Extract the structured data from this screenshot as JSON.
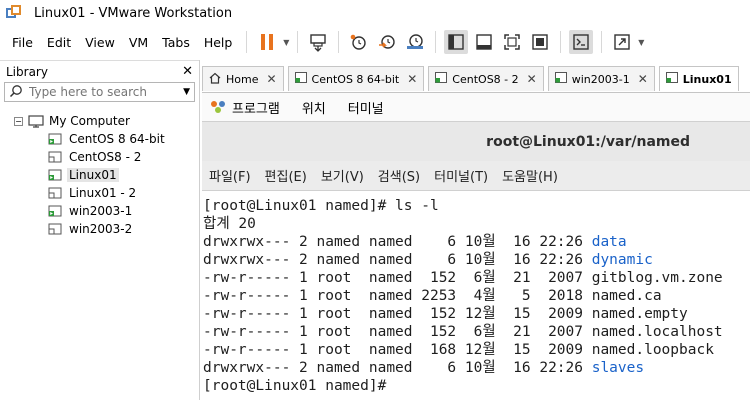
{
  "window": {
    "title": "Linux01 - VMware Workstation"
  },
  "menu": [
    "File",
    "Edit",
    "View",
    "VM",
    "Tabs",
    "Help"
  ],
  "toolbar": {
    "icons": [
      "pause-icon",
      "send-ctrl-alt-del-icon",
      "snapshot-icon",
      "revert-snapshot-icon",
      "snapshot-manager-icon",
      "library-view-icon",
      "thumbnail-view-icon",
      "fullscreen-icon",
      "unity-icon",
      "console-view-icon",
      "stretch-guest-icon"
    ],
    "colors": {
      "pause": "#e8731e",
      "accent": "#4a7fc0"
    }
  },
  "library": {
    "title": "Library",
    "search_placeholder": "Type here to search",
    "root": "My Computer",
    "items": [
      {
        "label": "CentOS 8 64-bit",
        "running": true,
        "selected": false
      },
      {
        "label": "CentOS8 - 2",
        "running": false,
        "selected": false
      },
      {
        "label": "Linux01",
        "running": true,
        "selected": true
      },
      {
        "label": "Linux01 - 2",
        "running": false,
        "selected": false
      },
      {
        "label": "win2003-1",
        "running": true,
        "selected": false
      },
      {
        "label": "win2003-2",
        "running": false,
        "selected": false
      }
    ]
  },
  "tabs": [
    {
      "label": "Home",
      "icon": "home-icon",
      "active": false
    },
    {
      "label": "CentOS 8 64-bit",
      "icon": "vm-icon",
      "active": false
    },
    {
      "label": "CentOS8 - 2",
      "icon": "vm-icon",
      "active": false
    },
    {
      "label": "win2003-1",
      "icon": "vm-icon",
      "active": false
    },
    {
      "label": "Linux01",
      "icon": "vm-icon",
      "active": true
    }
  ],
  "guest": {
    "top_bar": {
      "apps": "프로그램",
      "places": "위치",
      "terminal": "터미널"
    },
    "terminal_title": "root@Linux01:/var/named",
    "terminal_menu": [
      "파일(F)",
      "편집(E)",
      "보기(V)",
      "검색(S)",
      "터미널(T)",
      "도움말(H)"
    ],
    "lines": [
      {
        "text": "[root@Linux01 named]# ls -l"
      },
      {
        "text": "합계 20"
      },
      {
        "text": "drwxrwx--- 2 named named    6 10월  16 22:26 ",
        "name": "data",
        "color": "blue"
      },
      {
        "text": "drwxrwx--- 2 named named    6 10월  16 22:26 ",
        "name": "dynamic",
        "color": "blue"
      },
      {
        "text": "-rw-r----- 1 root  named  152  6월  21  2007 ",
        "name": "gitblog.vm.zone",
        "color": "default"
      },
      {
        "text": "-rw-r----- 1 root  named 2253  4월   5  2018 ",
        "name": "named.ca",
        "color": "default"
      },
      {
        "text": "-rw-r----- 1 root  named  152 12월  15  2009 ",
        "name": "named.empty",
        "color": "default"
      },
      {
        "text": "-rw-r----- 1 root  named  152  6월  21  2007 ",
        "name": "named.localhost",
        "color": "default"
      },
      {
        "text": "-rw-r----- 1 root  named  168 12월  15  2009 ",
        "name": "named.loopback",
        "color": "default"
      },
      {
        "text": "drwxrwx--- 2 named named    6 10월  16 22:26 ",
        "name": "slaves",
        "color": "blue"
      },
      {
        "text": "[root@Linux01 named]#"
      }
    ]
  }
}
